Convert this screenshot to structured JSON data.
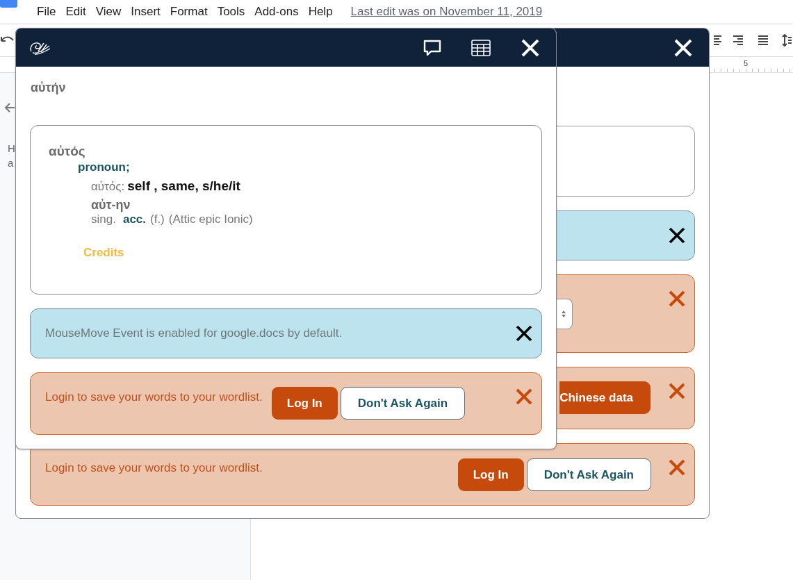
{
  "docs": {
    "menu": [
      {
        "label": "File"
      },
      {
        "label": "Edit"
      },
      {
        "label": "View"
      },
      {
        "label": "Insert"
      },
      {
        "label": "Format"
      },
      {
        "label": "Tools"
      },
      {
        "label": "Add-ons"
      },
      {
        "label": "Help"
      }
    ],
    "last_edit": "Last edit was on November 11, 2019",
    "ruler_mark": "5",
    "outline_letters": [
      "H",
      "a"
    ]
  },
  "back_panel": {
    "load_button": "Chinese data",
    "login_prompt": {
      "text": "Login to save your words to your wordlist.",
      "log_in": "Log In",
      "dont_ask": "Don't Ask Again"
    }
  },
  "front_panel": {
    "headword": "αὐτήν",
    "entry": {
      "lemma": "αὐτός",
      "part_of_speech": "pronoun;",
      "gloss_lemma": "αὐτός:",
      "gloss": "self , same, s/he/it",
      "form": "αὐτ-ην",
      "parse": [
        {
          "text": "sing.",
          "emphasis": false
        },
        {
          "text": "acc.",
          "emphasis": true
        },
        {
          "text": "(f.)",
          "emphasis": false
        },
        {
          "text": "(Attic epic Ionic)",
          "emphasis": false
        }
      ],
      "credits": "Credits"
    },
    "notice": "MouseMove Event is enabled for google.docs by default.",
    "login_prompt": {
      "text": "Login to save your words to your wordlist.",
      "log_in": "Log In",
      "dont_ask": "Don't Ask Again"
    }
  }
}
